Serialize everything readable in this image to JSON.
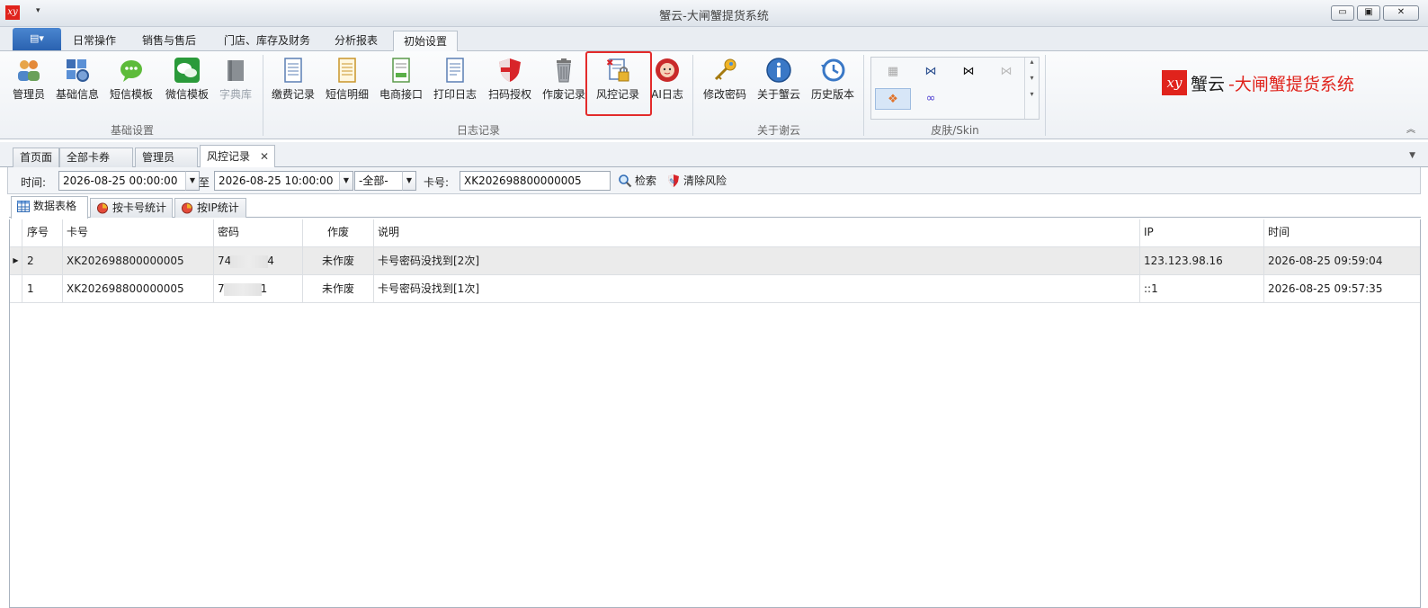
{
  "window": {
    "title": "蟹云-大闸蟹提货系统",
    "buttons": [
      "▭",
      "▣",
      "✕"
    ]
  },
  "menu": {
    "file_btn": "▤▾",
    "tabs": [
      "日常操作",
      "销售与售后",
      "门店、库存及财务",
      "分析报表",
      "初始设置"
    ],
    "active_tab": "初始设置"
  },
  "ribbon": {
    "groups": [
      {
        "label": "基础设置",
        "items": [
          "管理员",
          "基础信息",
          "短信模板",
          "微信模板",
          "字典库"
        ]
      },
      {
        "label": "日志记录",
        "items": [
          "缴费记录",
          "短信明细",
          "电商接口",
          "打印日志",
          "扫码授权",
          "作废记录",
          "风控记录",
          "AI日志"
        ]
      },
      {
        "label": "关于谢云",
        "items": [
          "修改密码",
          "关于蟹云",
          "历史版本"
        ]
      },
      {
        "label": "皮肤/Skin",
        "items": []
      }
    ],
    "highlighted_item": "风控记录",
    "brand": {
      "name": "蟹云",
      "suffix": "-大闸蟹提货系统",
      "logo_text": "xy"
    }
  },
  "doc_tabs": [
    "首页面",
    "全部卡券",
    "管理员",
    "风控记录"
  ],
  "active_doc_tab": "风控记录",
  "filter": {
    "time_label": "时间:",
    "time_from": "2026-08-25 00:00:00",
    "to_label": "至",
    "time_to": "2026-08-25 10:00:00",
    "status_value": "-全部-",
    "card_label": "卡号:",
    "card_value": "XK202698800000005",
    "search_label": "检索",
    "clear_label": "清除风险"
  },
  "sub_tabs": [
    "数据表格",
    "按卡号统计",
    "按IP统计"
  ],
  "active_sub_tab": "数据表格",
  "table": {
    "columns": [
      "序号",
      "卡号",
      "密码",
      "作废",
      "说明",
      "IP",
      "时间"
    ],
    "rows": [
      {
        "seq": "2",
        "card": "XK202698800000005",
        "pwd_a": "74",
        "pwd_b": "4",
        "void": "未作废",
        "desc": "卡号密码没找到[2次]",
        "ip": "123.123.98.16",
        "time": "2026-08-25 09:59:04",
        "selected": true
      },
      {
        "seq": "1",
        "card": "XK202698800000005",
        "pwd_a": "7",
        "pwd_b": "1",
        "void": "未作废",
        "desc": "卡号密码没找到[1次]",
        "ip": "::1",
        "time": "2026-08-25 09:57:35",
        "selected": false
      }
    ]
  },
  "colors": {
    "accent": "#2a62b0",
    "brand_red": "#e0231c",
    "highlight": "#e32b2b"
  }
}
